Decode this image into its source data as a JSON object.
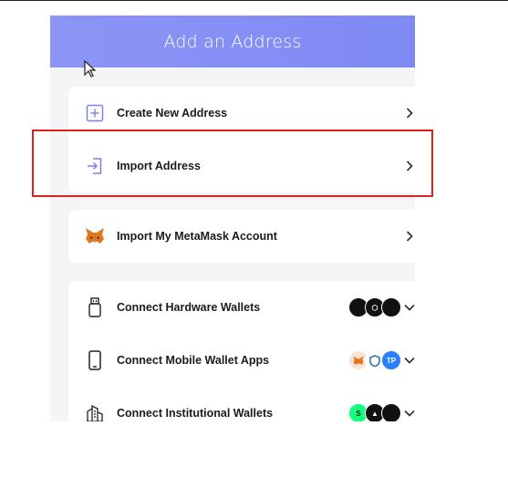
{
  "header": {
    "title": "Add an Address"
  },
  "primary_actions": [
    {
      "label": "Create New Address",
      "icon": "plus-square-icon"
    },
    {
      "label": "Import Address",
      "icon": "import-arrow-icon"
    }
  ],
  "metamask": {
    "label": "Import My MetaMask Account",
    "icon": "metamask-fox-icon"
  },
  "connections": [
    {
      "label": "Connect Hardware Wallets",
      "icon": "usb-device-icon",
      "badges": [
        "ledger-icon",
        "trezor-icon",
        "keystone-icon"
      ]
    },
    {
      "label": "Connect Mobile Wallet Apps",
      "icon": "mobile-phone-icon",
      "badges": [
        "metamask-icon",
        "trust-wallet-icon",
        "tokenpocket-icon"
      ],
      "badge_text": [
        "",
        "",
        "TP"
      ]
    },
    {
      "label": "Connect Institutional Wallets",
      "icon": "institution-building-icon",
      "badges": [
        "gnosis-safe-icon",
        "coboargus-icon",
        "custody-icon"
      ]
    }
  ],
  "colors": {
    "header": "#8c95f5",
    "accent_icon": "#7b83eb",
    "highlight": "#e02020"
  }
}
